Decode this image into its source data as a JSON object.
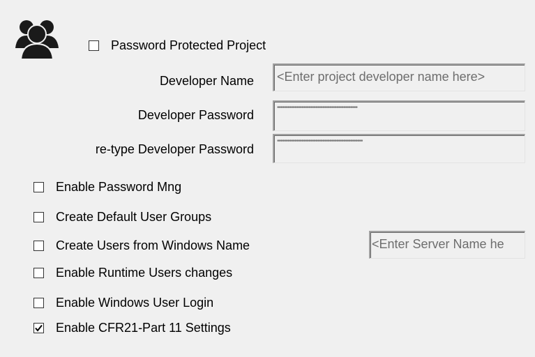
{
  "header": {
    "icon": "users-group-icon",
    "password_protected_label": "Password Protected Project",
    "password_protected_checked": false
  },
  "developer": {
    "name_label": "Developer Name",
    "name_placeholder": "<Enter project developer name here>",
    "password_label": "Developer Password",
    "password_value": "••••••••••••••••••••••••••••••••••••••••••••••",
    "retype_label": "re-type Developer Password",
    "retype_value": "•••••••••••••••••••••••••••••••••••••••••••••••••"
  },
  "options": [
    {
      "label": "Enable Password Mng",
      "checked": false
    },
    {
      "label": "Create Default User Groups",
      "checked": false
    },
    {
      "label": "Create Users from Windows Name",
      "checked": false
    },
    {
      "label": "Enable Runtime Users changes",
      "checked": false
    },
    {
      "label": "Enable Windows User Login",
      "checked": false
    },
    {
      "label": "Enable CFR21-Part 11 Settings",
      "checked": true
    }
  ],
  "server": {
    "placeholder": "<Enter Server Name he"
  },
  "colors": {
    "panel_bg": "#f0f0f0",
    "field_text": "#6d6d6d",
    "icon": "#1a1a1a"
  }
}
